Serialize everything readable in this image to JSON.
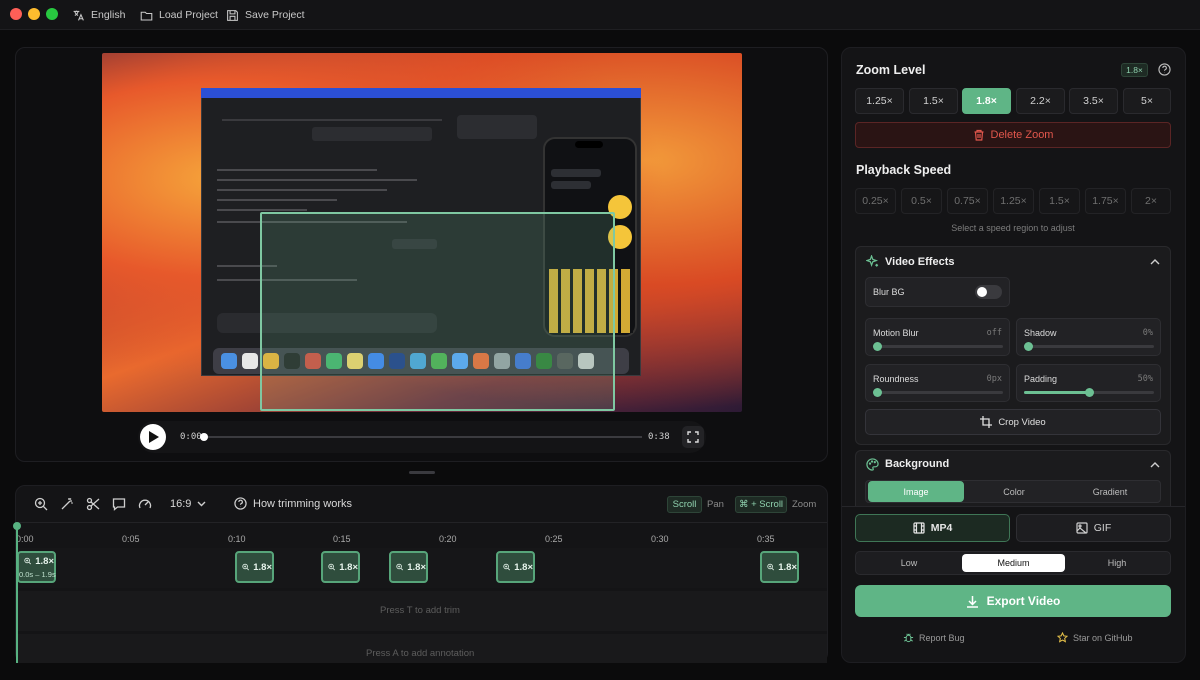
{
  "titlebar": {
    "language": "English",
    "load": "Load Project",
    "save": "Save Project"
  },
  "player": {
    "current": "0:00",
    "duration": "0:38",
    "progress": 0.0
  },
  "timeline": {
    "aspect": "16:9",
    "help": "How trimming works",
    "scroll_key": "Scroll",
    "scroll_action": "Pan",
    "zoom_key": "⌘ + Scroll",
    "zoom_action": "Zoom",
    "ticks": [
      "0:00",
      "0:05",
      "0:10",
      "0:15",
      "0:20",
      "0:25",
      "0:30",
      "0:35"
    ],
    "zoom_chips": [
      "1.8×",
      "1.8×",
      "1.8×",
      "1.8×",
      "1.8×",
      "1.8×"
    ],
    "first_chip_range": "0.0s – 1.9s",
    "trim_hint": "Press T to add trim",
    "annotation_hint": "Press A to add annotation"
  },
  "zoom": {
    "title": "Zoom Level",
    "badge": "1.8×",
    "levels": [
      "1.25×",
      "1.5×",
      "1.8×",
      "2.2×",
      "3.5×",
      "5×"
    ],
    "selected": "1.8×",
    "delete": "Delete Zoom"
  },
  "speed": {
    "title": "Playback Speed",
    "levels": [
      "0.25×",
      "0.5×",
      "0.75×",
      "1.25×",
      "1.5×",
      "1.75×",
      "2×"
    ],
    "hint": "Select a speed region to adjust"
  },
  "effects": {
    "title": "Video Effects",
    "blur_bg": "Blur BG",
    "blur_bg_on": false,
    "motion_blur": {
      "label": "Motion Blur",
      "value": "off",
      "level": 0.0
    },
    "shadow": {
      "label": "Shadow",
      "value": "0%",
      "level": 0.0
    },
    "roundness": {
      "label": "Roundness",
      "value": "0px",
      "level": 0.0
    },
    "padding": {
      "label": "Padding",
      "value": "50%",
      "level": 0.5
    },
    "crop": "Crop Video"
  },
  "background": {
    "title": "Background",
    "tabs": [
      "Image",
      "Color",
      "Gradient"
    ],
    "selected": "Image"
  },
  "export": {
    "formats": [
      "MP4",
      "GIF"
    ],
    "selected_format": "MP4",
    "qualities": [
      "Low",
      "Medium",
      "High"
    ],
    "selected_quality": "Medium",
    "button": "Export Video",
    "report": "Report Bug",
    "star": "Star on GitHub"
  },
  "colors": {
    "accent": "#5fb586",
    "danger": "#e2574c",
    "bg": "#0b0b0c"
  }
}
